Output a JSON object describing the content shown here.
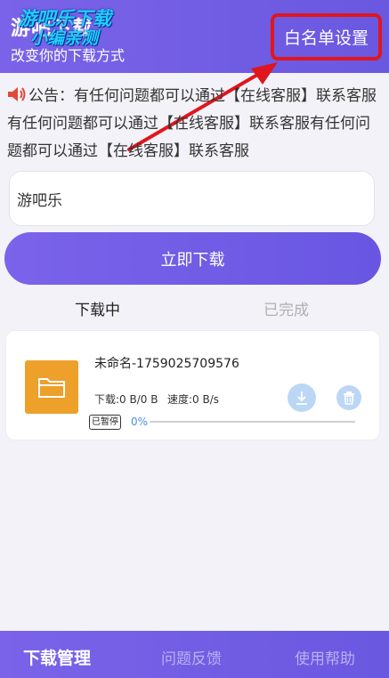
{
  "header": {
    "title": "游吧下载",
    "subtitle": "改变你的下载方式",
    "watermark_line1": "游吧乐下载",
    "watermark_line2": "小编亲测",
    "whitelist_label": "白名单设置"
  },
  "notice": {
    "text": "公告：有任何问题都可以通过【在线客服】联系客服有任何问题都可以通过【在线客服】联系客服有任何问题都可以通过【在线客服】联系客服"
  },
  "input": {
    "value": "游吧乐"
  },
  "download_button": "立即下载",
  "tabs": [
    {
      "label": "下载中",
      "active": true
    },
    {
      "label": "已完成",
      "active": false
    }
  ],
  "download_item": {
    "name": "未命名-1759025709576",
    "downloaded_label": "下载:0 B/0 B",
    "speed_label": "速度:0 B/s",
    "status": "已暂停",
    "progress_text": "0%",
    "progress": 0
  },
  "bottom_nav": [
    {
      "label": "下载管理",
      "active": true
    },
    {
      "label": "问题反馈",
      "active": false
    },
    {
      "label": "使用帮助",
      "active": false
    }
  ],
  "colors": {
    "brand": "#7a63e8",
    "highlight": "#e0161e",
    "folder": "#eda02a",
    "progress": "#4a90e2"
  }
}
